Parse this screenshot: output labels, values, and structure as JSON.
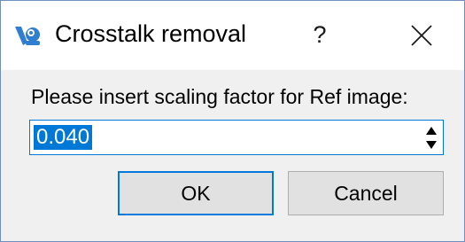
{
  "window": {
    "title": "Crosstalk removal",
    "help_label": "?",
    "app_icon": "app-logo-icon",
    "close_icon": "close-icon"
  },
  "dialog": {
    "prompt": "Please insert scaling factor for Ref image:",
    "input": {
      "value": "0.040",
      "selected": true
    },
    "ok_label": "OK",
    "cancel_label": "Cancel"
  },
  "colors": {
    "accent": "#0078d7",
    "dialog_bg": "#f0f0f0",
    "button_bg": "#e1e1e1",
    "icon_blue": "#2f7ecf"
  }
}
